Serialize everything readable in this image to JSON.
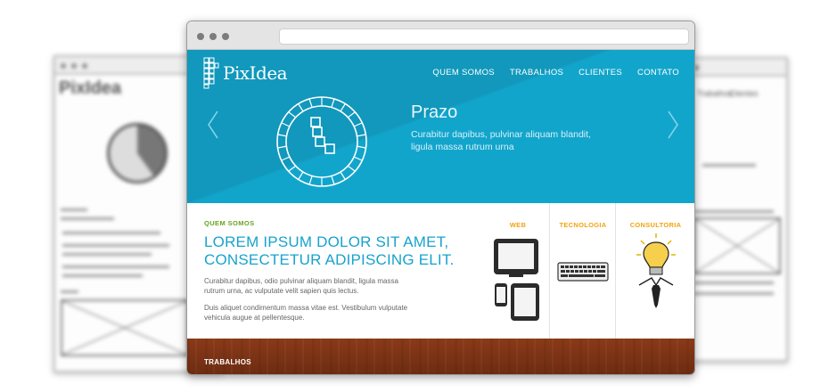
{
  "background_left": {
    "logo": "PixIdea"
  },
  "background_right": {
    "nav_items": [
      "Trabalhos",
      "Clientes"
    ]
  },
  "site": {
    "logo": "PixIdea",
    "nav": [
      "QUEM SOMOS",
      "TRABALHOS",
      "CLIENTES",
      "CONTATO"
    ]
  },
  "hero": {
    "title": "Prazo",
    "text": "Curabitur dapibus, pulvinar aliquam blandit, ligula massa rutrum urna"
  },
  "about": {
    "label": "QUEM SOMOS",
    "heading": "LOREM IPSUM DOLOR SIT AMET, CONSECTETUR ADIPISCING ELIT.",
    "paragraph1": "Curabitur dapibus, odio pulvinar aliquam blandit, ligula massa rutrum urna, ac vulputate velit sapien quis lectus.",
    "paragraph2": "Duis aliquet condimentum massa vitae est. Vestibulum vulputate vehicula augue at pellentesque."
  },
  "services": [
    {
      "title": "WEB",
      "icon": "devices-icon"
    },
    {
      "title": "TECNOLOGIA",
      "icon": "keyboard-icon"
    },
    {
      "title": "CONSULTORIA",
      "icon": "lightbulb-person-icon"
    }
  ],
  "footer": {
    "label": "TRABALHOS"
  },
  "colors": {
    "hero_blue": "#12a5cc",
    "heading_blue": "#17a3cc",
    "label_green": "#6aa322",
    "service_orange": "#f2a30f",
    "footer_wood": "#7a3315"
  }
}
